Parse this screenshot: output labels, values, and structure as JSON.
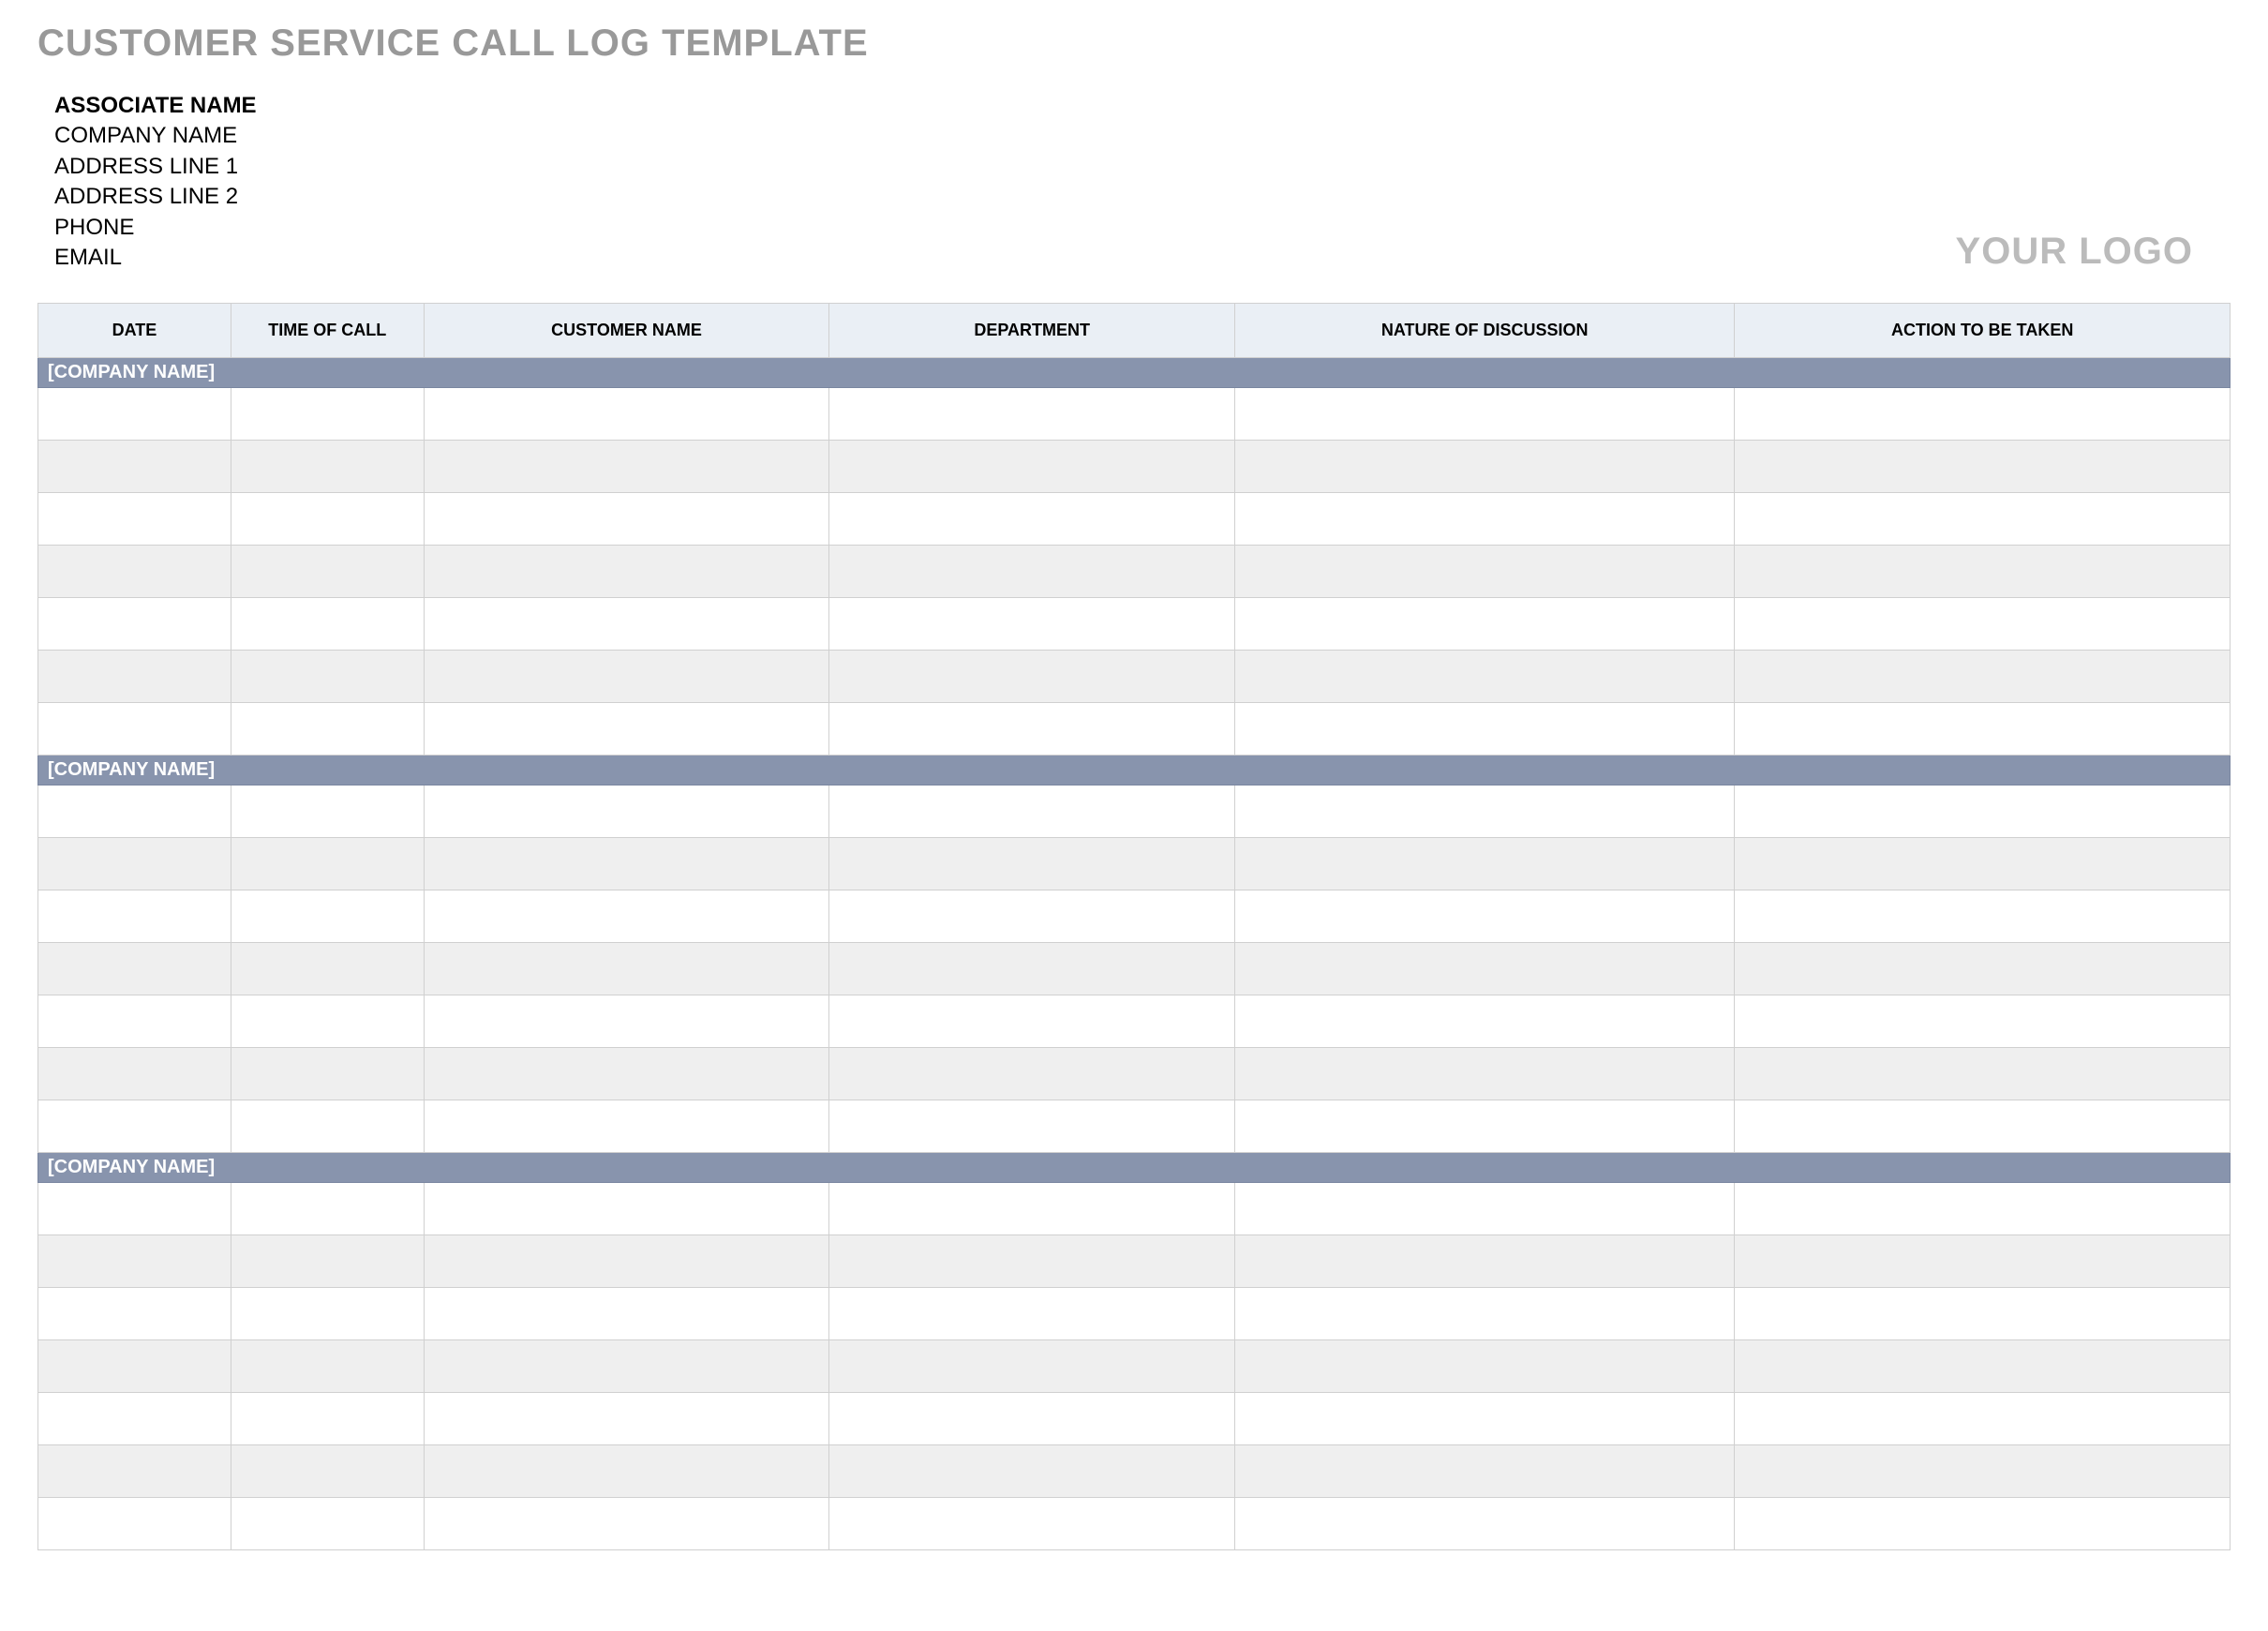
{
  "title": "CUSTOMER SERVICE CALL LOG TEMPLATE",
  "info": {
    "associate_label": "ASSOCIATE NAME",
    "company": "COMPANY NAME",
    "address1": "ADDRESS LINE 1",
    "address2": "ADDRESS LINE 2",
    "phone": "PHONE",
    "email": "EMAIL"
  },
  "logo_text": "YOUR LOGO",
  "columns": {
    "date": "DATE",
    "time": "TIME OF CALL",
    "customer": "CUSTOMER NAME",
    "department": "DEPARTMENT",
    "nature": "NATURE OF DISCUSSION",
    "action": "ACTION TO BE TAKEN"
  },
  "sections": [
    {
      "header": "[COMPANY NAME]",
      "rows": 7
    },
    {
      "header": "[COMPANY NAME]",
      "rows": 7
    },
    {
      "header": "[COMPANY NAME]",
      "rows": 7
    }
  ]
}
